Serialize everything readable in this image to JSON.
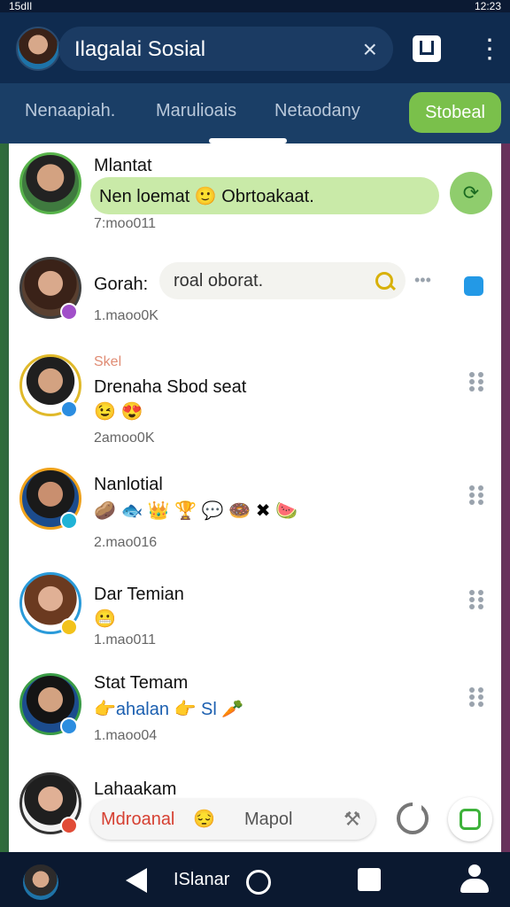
{
  "statusbar": {
    "left": "15dIl",
    "right": "12:23"
  },
  "header": {
    "title": "Ilagalai Sosial",
    "close_icon": "×"
  },
  "tabs": [
    {
      "label": "Nenaapiah."
    },
    {
      "label": "Marulioais"
    },
    {
      "label": "Netaodany"
    }
  ],
  "tab_button": {
    "label": "Stobeal"
  },
  "chats": [
    {
      "name": "Mlantat",
      "message": "Nen loemat 🙂 Obrtoakaat.",
      "time": "7:moo011"
    },
    {
      "name": "Gorah:",
      "message": "roal oborat.",
      "time": "1.maoo0K"
    },
    {
      "tag": "Skel",
      "name": "Drenaha Sbod seat",
      "emojis": "😉 😍",
      "time": "2amoo0K"
    },
    {
      "name": "Nanlotial",
      "emojis": "🥔 🐟 👑 🏆 💬 🍩 ✖ 🍉",
      "time": "2.mao016"
    },
    {
      "name": "Dar Temian",
      "emojis": "😬",
      "time": "1.mao011"
    },
    {
      "name": "Stat Temam",
      "message": "👉ahalan 👉 Sl 🥕",
      "time": "1.maoo04"
    },
    {
      "name": "Lahaakam"
    }
  ],
  "compose": {
    "red_text": "Mdroanal",
    "emoji": "😔",
    "placeholder": "Mapol"
  },
  "bottom_nav": {
    "label": "ISlanar"
  },
  "colors": {
    "header": "#0f2b4f",
    "tabs": "#1a3e66",
    "accent_green": "#7ac04b",
    "badge_purple": "#a14fc9",
    "badge_blue": "#2b8de0",
    "badge_yellow": "#f2c21b",
    "badge_red": "#e14b36"
  },
  "icons": [
    "close-icon",
    "book-icon",
    "more-vertical-icon",
    "refresh-icon",
    "search-icon",
    "back-icon",
    "home-icon",
    "recents-icon",
    "profile-icon"
  ]
}
